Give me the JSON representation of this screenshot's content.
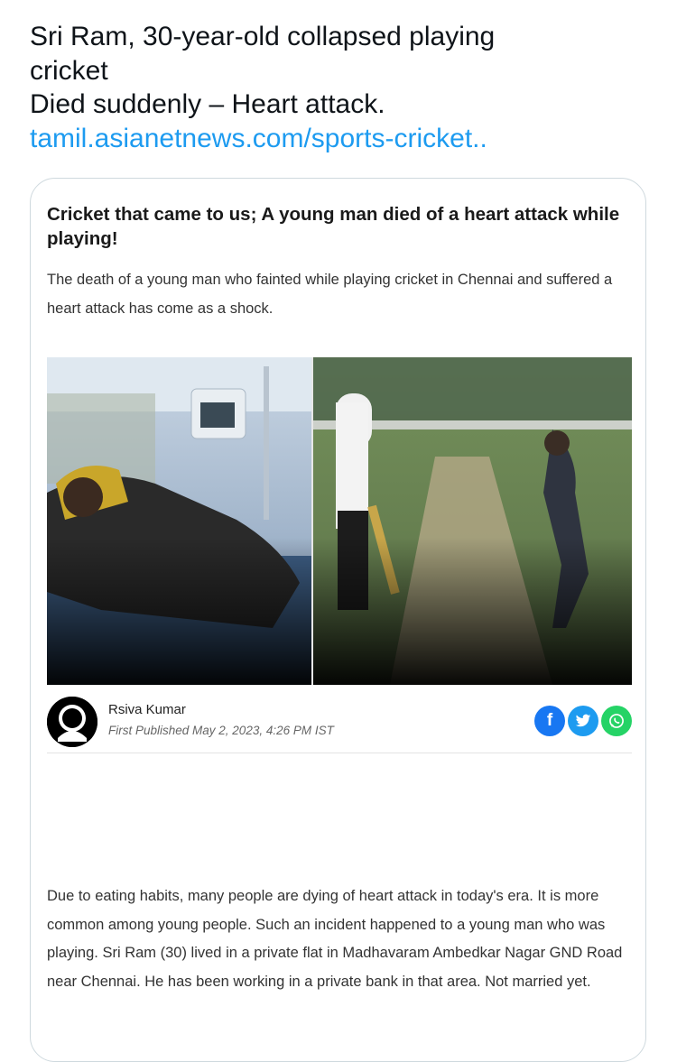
{
  "tweet": {
    "line1": "Sri Ram, 30-year-old collapsed playing",
    "line2": "cricket",
    "line3": "Died suddenly – Heart attack.",
    "link": "tamil.asianetnews.com/sports-cricket.."
  },
  "card": {
    "headline": "Cricket that came to us; A young man died of a heart attack while playing!",
    "summary": "The death of a young man who fainted while playing cricket in Chennai and suffered a heart attack has come as a shock.",
    "author": "Rsiva Kumar",
    "published": "First Published May 2, 2023, 4:26 PM IST",
    "share": {
      "facebook": "f",
      "twitter": "twitter-bird-icon",
      "whatsapp": "whatsapp-icon"
    },
    "body": "Due to eating habits, many people are dying of heart attack in today's era. It is more common among young people. Such an incident happened to a young man who was playing. Sri Ram (30) lived in a private flat in Madhavaram Ambedkar Nagar GND Road near Chennai. He has been working in a private bank in that area. Not married yet."
  },
  "colors": {
    "link": "#1d9bf0",
    "facebook": "#1877f2",
    "twitter": "#1d9bf0",
    "whatsapp": "#25d366",
    "card_border": "#cfd9de"
  }
}
